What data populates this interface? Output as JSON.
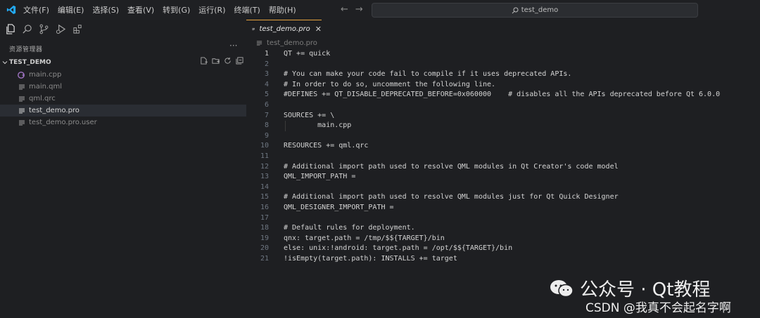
{
  "menu": [
    "文件(F)",
    "编辑(E)",
    "选择(S)",
    "查看(V)",
    "转到(G)",
    "运行(R)",
    "终端(T)",
    "帮助(H)"
  ],
  "search": {
    "text": "test_demo"
  },
  "sidebar": {
    "title": "资源管理器",
    "more": "···",
    "project": "TEST_DEMO",
    "files": [
      "main.cpp",
      "main.qml",
      "qml.qrc",
      "test_demo.pro",
      "test_demo.pro.user"
    ]
  },
  "tab": {
    "label": "test_demo.pro",
    "close": "✕"
  },
  "breadcrumb": "test_demo.pro",
  "code": {
    "lines": [
      "QT += quick",
      "",
      "# You can make your code fail to compile if it uses deprecated APIs.",
      "# In order to do so, uncomment the following line.",
      "#DEFINES += QT_DISABLE_DEPRECATED_BEFORE=0x060000    # disables all the APIs deprecated before Qt 6.0.0",
      "",
      "SOURCES += \\",
      "        main.cpp",
      "",
      "RESOURCES += qml.qrc",
      "",
      "# Additional import path used to resolve QML modules in Qt Creator's code model",
      "QML_IMPORT_PATH =",
      "",
      "# Additional import path used to resolve QML modules just for Qt Quick Designer",
      "QML_DESIGNER_IMPORT_PATH =",
      "",
      "# Default rules for deployment.",
      "qnx: target.path = /tmp/$${TARGET}/bin",
      "else: unix:!android: target.path = /opt/$${TARGET}/bin",
      "!isEmpty(target.path): INSTALLS += target",
      ""
    ],
    "numbers": [
      "1",
      "2",
      "3",
      "4",
      "5",
      "6",
      "7",
      "8",
      "9",
      "10",
      "11",
      "12",
      "13",
      "14",
      "15",
      "16",
      "17",
      "18",
      "19",
      "20",
      "21"
    ]
  },
  "watermark": {
    "line1": "公众号 · Qt教程",
    "line2": "CSDN @我真不会起名字啊"
  },
  "colors": {
    "accent": "#e7a33e",
    "vscode_blue": "#23a9f2",
    "cpp_purple": "#a074c4"
  }
}
